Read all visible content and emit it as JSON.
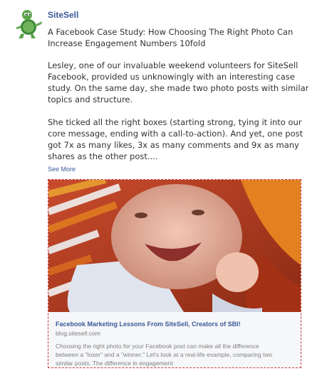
{
  "post": {
    "page_name": "SiteSell",
    "title": "A Facebook Case Study: How Choosing The Right Photo Can Increase Engagement Numbers 10fold",
    "paragraphs": [
      "Lesley, one of our invaluable weekend volunteers for SiteSell Facebook, provided us unknowingly with an interesting case study. On the same day, she made two photo posts with similar topics and structure.",
      "She ticked all the right boxes (starting strong, tying it into our core message, ending with a call-to-action). And yet, one post got 7x as many likes, 3x as many comments and 9x as many shares as the other post...."
    ],
    "see_more": "See More"
  },
  "attachment": {
    "title": "Facebook Marketing Lessons From SiteSell, Creators of SBI!",
    "domain": "blog.sitesell.com",
    "description": "Choosing the right photo for your Facebook post can make all the difference between a \"loser\" and a \"winner.\" Let's look at a real-life example, comparing two similar posts. The difference in engagement"
  }
}
